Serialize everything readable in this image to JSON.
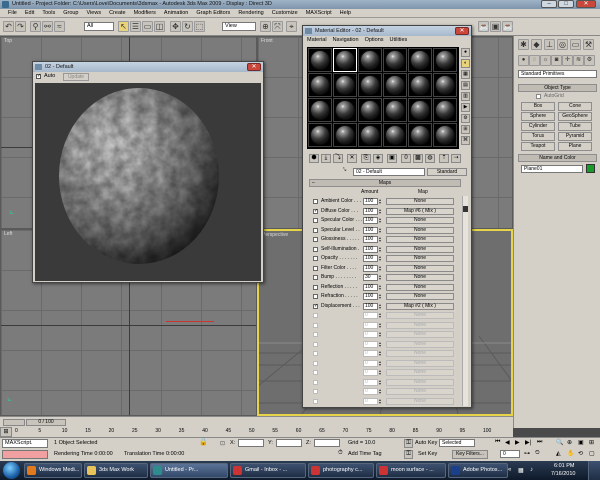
{
  "window": {
    "title": "Untitled    - Project Folder: C:\\Users\\Love\\Documents\\3dsmax      - Autodesk 3ds Max  2009      - Display : Direct 3D"
  },
  "menu": [
    "File",
    "Edit",
    "Tools",
    "Group",
    "Views",
    "Create",
    "Modifiers",
    "Animation",
    "Graph Editors",
    "Rendering",
    "Customize",
    "MAXScript",
    "Help"
  ],
  "toolbar": {
    "selection_filter": "All",
    "ref_coord": "View"
  },
  "viewports": {
    "top": "Top",
    "front": "Front",
    "left": "Left",
    "perspective": "Perspective"
  },
  "preview_window": {
    "title": "02 - Default",
    "auto_label": "Auto",
    "update_label": "Update"
  },
  "material_editor": {
    "title": "Material Editor - 02 - Default",
    "menu": [
      "Material",
      "Navigation",
      "Options",
      "Utilities"
    ],
    "material_name": "02 - Default",
    "material_type": "Standard",
    "maps_header": "Maps",
    "col_amount": "Amount",
    "col_map": "Map",
    "maps": [
      {
        "name": "Ambient Color . . .",
        "amount": "100",
        "map": "None",
        "checked": false,
        "dim": false
      },
      {
        "name": "Diffuse Color . . .",
        "amount": "100",
        "map": "Map #6  ( Mix )",
        "checked": true,
        "dim": false
      },
      {
        "name": "Specular Color . . .",
        "amount": "100",
        "map": "None",
        "checked": false,
        "dim": false
      },
      {
        "name": "Specular Level . .",
        "amount": "100",
        "map": "None",
        "checked": false,
        "dim": false
      },
      {
        "name": "Glossiness . . . . .",
        "amount": "100",
        "map": "None",
        "checked": false,
        "dim": false
      },
      {
        "name": "Self-Illumination .",
        "amount": "100",
        "map": "None",
        "checked": false,
        "dim": false
      },
      {
        "name": "Opacity . . . . . . .",
        "amount": "100",
        "map": "None",
        "checked": false,
        "dim": false
      },
      {
        "name": "Filter Color . . . .",
        "amount": "100",
        "map": "None",
        "checked": false,
        "dim": false
      },
      {
        "name": "Bump . . . . . . . .",
        "amount": "30",
        "map": "None",
        "checked": false,
        "dim": false
      },
      {
        "name": "Reflection . . . . .",
        "amount": "100",
        "map": "None",
        "checked": false,
        "dim": false
      },
      {
        "name": "Refraction . . . . .",
        "amount": "100",
        "map": "None",
        "checked": false,
        "dim": false
      },
      {
        "name": "Displacement . . .",
        "amount": "100",
        "map": "Map #2  ( Mix )",
        "checked": true,
        "dim": false
      },
      {
        "name": "",
        "amount": "0",
        "map": "None",
        "checked": false,
        "dim": true
      },
      {
        "name": "",
        "amount": "0",
        "map": "None",
        "checked": false,
        "dim": true
      },
      {
        "name": "",
        "amount": "0",
        "map": "None",
        "checked": false,
        "dim": true
      },
      {
        "name": "",
        "amount": "0",
        "map": "None",
        "checked": false,
        "dim": true
      },
      {
        "name": "",
        "amount": "0",
        "map": "None",
        "checked": false,
        "dim": true
      },
      {
        "name": "",
        "amount": "0",
        "map": "None",
        "checked": false,
        "dim": true
      },
      {
        "name": "",
        "amount": "0",
        "map": "None",
        "checked": false,
        "dim": true
      },
      {
        "name": "",
        "amount": "0",
        "map": "None",
        "checked": false,
        "dim": true
      },
      {
        "name": "",
        "amount": "0",
        "map": "None",
        "checked": false,
        "dim": true
      },
      {
        "name": "",
        "amount": "0",
        "map": "None",
        "checked": false,
        "dim": true
      }
    ]
  },
  "command_panel": {
    "dropdown": "Standard Primitives",
    "object_type_header": "Object Type",
    "autogrid": "AutoGrid",
    "buttons": [
      "Box",
      "Cone",
      "Sphere",
      "GeoSphere",
      "Cylinder",
      "Tube",
      "Torus",
      "Pyramid",
      "Teapot",
      "Plane"
    ],
    "name_color_header": "Name and Color",
    "object_name": "Plane01",
    "object_color": "#1a9a2a"
  },
  "timeline": {
    "frame_display": "0 / 100",
    "ticks": [
      "0",
      "5",
      "10",
      "15",
      "20",
      "25",
      "30",
      "35",
      "40",
      "45",
      "50",
      "55",
      "60",
      "65",
      "70",
      "75",
      "80",
      "85",
      "90",
      "95",
      "100"
    ]
  },
  "status": {
    "maxscript": "MAXScript.",
    "selection": "1 Object Selected",
    "rendering_time": "Rendering Time  0:00:00",
    "translation_time": "Translation Time  0:00:00",
    "x_label": "X:",
    "y_label": "Y:",
    "z_label": "Z:",
    "grid": "Grid = 10.0",
    "add_time_tag": "Add Time Tag",
    "auto_key": "Auto Key",
    "set_key": "Set Key",
    "key_mode": "Selected",
    "key_filters": "Key Filters...",
    "frame": "0"
  },
  "taskbar": {
    "items": [
      {
        "label": "Windows Medi...",
        "color": "#e07a1c"
      },
      {
        "label": "3ds Max Work",
        "color": "#e8c35a"
      },
      {
        "label": "Untitled     - Pr...",
        "color": "#2e8c8c"
      },
      {
        "label": "Gmail - Inbox - ...",
        "color": "#cc3333"
      },
      {
        "label": "photography c...",
        "color": "#cc3333"
      },
      {
        "label": "moon surface - ...",
        "color": "#cc3333"
      },
      {
        "label": "Adobe Photos...",
        "color": "#1c3f8c"
      }
    ],
    "time": "6:01 PM",
    "date": "7/16/2010"
  }
}
